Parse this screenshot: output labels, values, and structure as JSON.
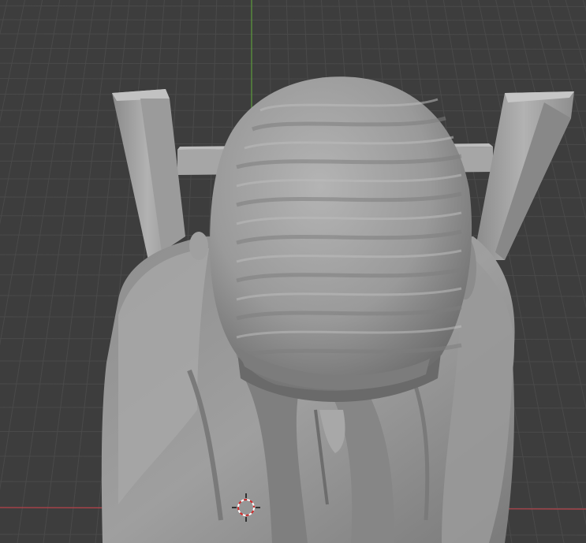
{
  "viewport": {
    "background": "#3d3d3d",
    "grid_color": "#4a4a4a",
    "y_axis_color": "#5d9b3c",
    "x_axis_color": "#b7424a",
    "model_color": "#9a9a9a"
  },
  "scene": {
    "objects": [
      "chair",
      "sculpted-figure"
    ],
    "cursor_icon": "3d-cursor-icon"
  }
}
